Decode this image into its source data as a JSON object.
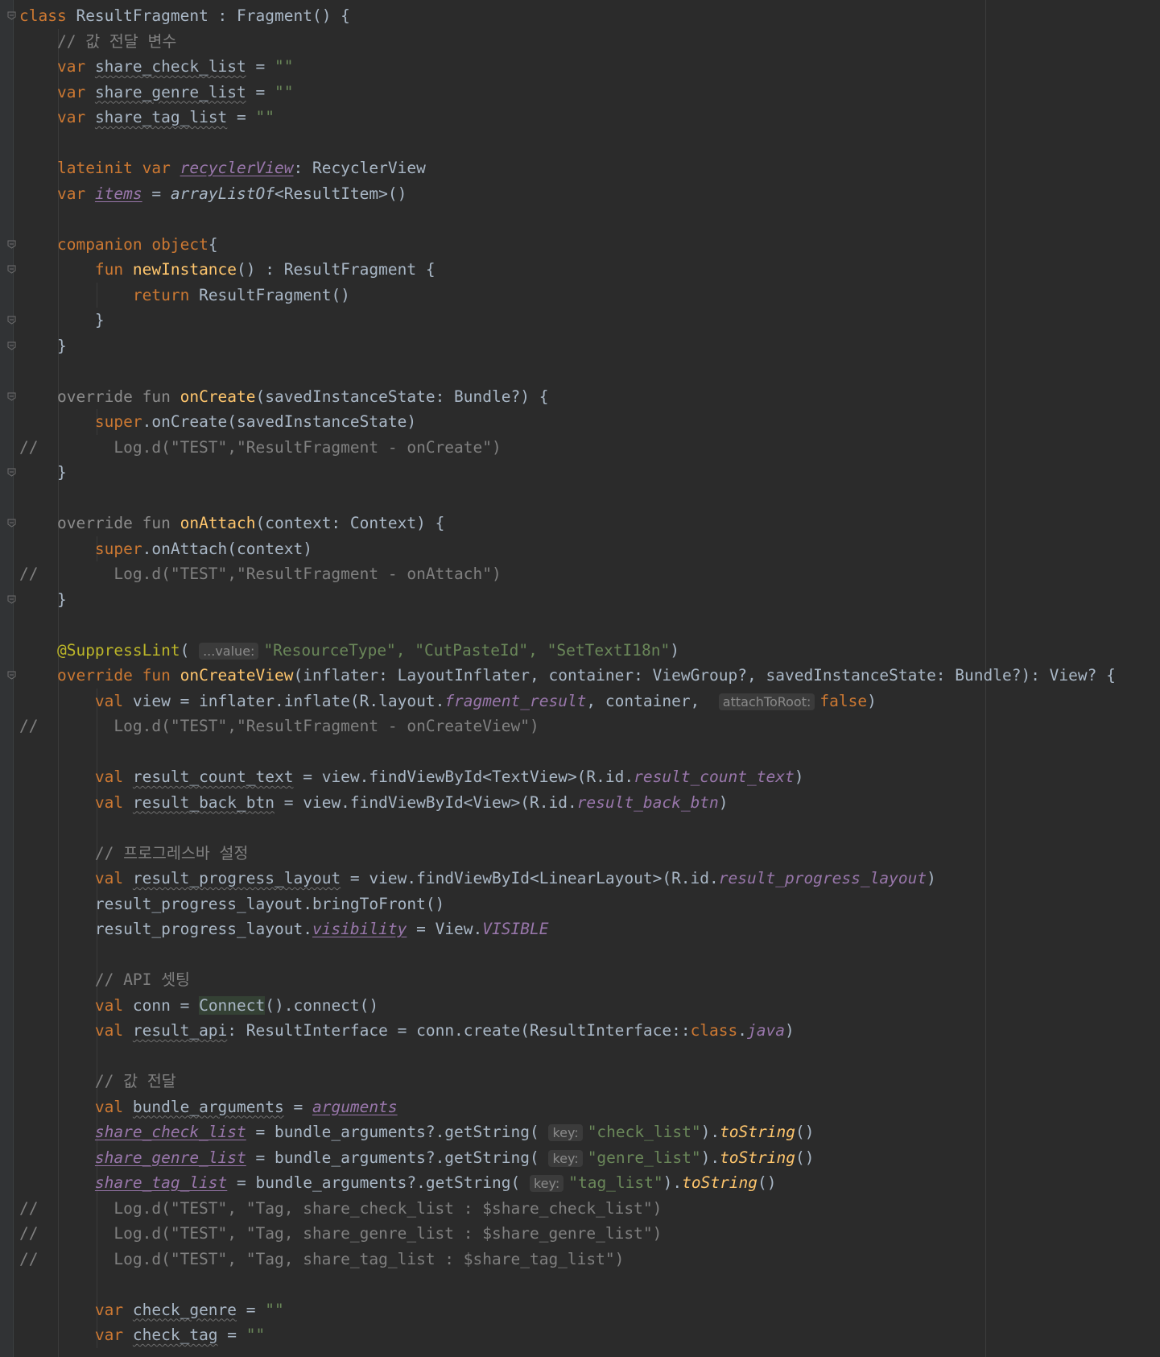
{
  "editor": {
    "language": "Kotlin",
    "lines": [
      [
        {
          "t": "class ",
          "c": "kw"
        },
        {
          "t": "ResultFragment : Fragment() {"
        }
      ],
      [
        {
          "t": "    "
        },
        {
          "t": "// 값 전달 변수",
          "c": "com"
        }
      ],
      [
        {
          "t": "    "
        },
        {
          "t": "var ",
          "c": "kw"
        },
        {
          "t": "share_check_list",
          "c": "wavy"
        },
        {
          "t": " = "
        },
        {
          "t": "\"\"",
          "c": "str"
        }
      ],
      [
        {
          "t": "    "
        },
        {
          "t": "var ",
          "c": "kw"
        },
        {
          "t": "share_genre_list",
          "c": "wavy"
        },
        {
          "t": " = "
        },
        {
          "t": "\"\"",
          "c": "str"
        }
      ],
      [
        {
          "t": "    "
        },
        {
          "t": "var ",
          "c": "kw"
        },
        {
          "t": "share_tag_list",
          "c": "wavy"
        },
        {
          "t": " = "
        },
        {
          "t": "\"\"",
          "c": "str"
        }
      ],
      [],
      [
        {
          "t": "    "
        },
        {
          "t": "lateinit var ",
          "c": "kw"
        },
        {
          "t": "recyclerView",
          "c": "link-prop"
        },
        {
          "t": ": RecyclerView"
        }
      ],
      [
        {
          "t": "    "
        },
        {
          "t": "var ",
          "c": "kw"
        },
        {
          "t": "items",
          "c": "link-prop"
        },
        {
          "t": " = "
        },
        {
          "t": "arrayListOf",
          "c": "ext"
        },
        {
          "t": "<ResultItem>()"
        }
      ],
      [],
      [
        {
          "t": "    "
        },
        {
          "t": "companion object",
          "c": "kw"
        },
        {
          "t": "{"
        }
      ],
      [
        {
          "t": "        "
        },
        {
          "t": "fun ",
          "c": "kw"
        },
        {
          "t": "newInstance",
          "c": "fn"
        },
        {
          "t": "() : ResultFragment {"
        }
      ],
      [
        {
          "t": "            "
        },
        {
          "t": "return ",
          "c": "kw"
        },
        {
          "t": "ResultFragment()"
        }
      ],
      [
        {
          "t": "        }"
        }
      ],
      [
        {
          "t": "    }"
        }
      ],
      [],
      [
        {
          "t": "    "
        },
        {
          "t": "override fun ",
          "c": "grey"
        },
        {
          "t": "onCreate",
          "c": "fn"
        },
        {
          "t": "(savedInstanceState: Bundle?) {"
        }
      ],
      [
        {
          "t": "        "
        },
        {
          "t": "super",
          "c": "kw"
        },
        {
          "t": ".onCreate(savedInstanceState)"
        }
      ],
      [
        {
          "t": "          Log.d(\"TEST\",\"ResultFragment - onCreate\")",
          "c": "com"
        }
      ],
      [
        {
          "t": "    }"
        }
      ],
      [],
      [
        {
          "t": "    "
        },
        {
          "t": "override fun ",
          "c": "grey"
        },
        {
          "t": "onAttach",
          "c": "fn"
        },
        {
          "t": "(context: Context) {"
        }
      ],
      [
        {
          "t": "        "
        },
        {
          "t": "super",
          "c": "kw"
        },
        {
          "t": ".onAttach(context)"
        }
      ],
      [
        {
          "t": "          Log.d(\"TEST\",\"ResultFragment - onAttach\")",
          "c": "com"
        }
      ],
      [
        {
          "t": "    }"
        }
      ],
      [],
      [
        {
          "t": "    "
        },
        {
          "t": "@SuppressLint",
          "c": "ann"
        },
        {
          "t": "( "
        },
        {
          "t": "...value:",
          "c": "hint"
        },
        {
          "t": "\"ResourceType\", \"CutPasteId\", \"SetTextI18n\"",
          "c": "str"
        },
        {
          "t": ")"
        }
      ],
      [
        {
          "t": "    "
        },
        {
          "t": "override fun ",
          "c": "kw"
        },
        {
          "t": "onCreateView",
          "c": "fn"
        },
        {
          "t": "(inflater: LayoutInflater, container: ViewGroup?, savedInstanceState: Bundle?): View? {"
        }
      ],
      [
        {
          "t": "        "
        },
        {
          "t": "val ",
          "c": "kw"
        },
        {
          "t": "view = inflater.inflate(R.layout."
        },
        {
          "t": "fragment_result",
          "c": "prop"
        },
        {
          "t": ", container,  "
        },
        {
          "t": "attachToRoot:",
          "c": "hint"
        },
        {
          "t": "false",
          "c": "kw"
        },
        {
          "t": ")"
        }
      ],
      [
        {
          "t": "          Log.d(\"TEST\",\"ResultFragment - onCreateView\")",
          "c": "com"
        }
      ],
      [],
      [
        {
          "t": "        "
        },
        {
          "t": "val ",
          "c": "kw"
        },
        {
          "t": "result_count_text",
          "c": "wavy"
        },
        {
          "t": " = view.findViewById<TextView>(R.id."
        },
        {
          "t": "result_count_text",
          "c": "prop"
        },
        {
          "t": ")"
        }
      ],
      [
        {
          "t": "        "
        },
        {
          "t": "val ",
          "c": "kw"
        },
        {
          "t": "result_back_btn",
          "c": "wavy"
        },
        {
          "t": " = view.findViewById<View>(R.id."
        },
        {
          "t": "result_back_btn",
          "c": "prop"
        },
        {
          "t": ")"
        }
      ],
      [],
      [
        {
          "t": "        "
        },
        {
          "t": "// 프로그레스바 설정",
          "c": "com"
        }
      ],
      [
        {
          "t": "        "
        },
        {
          "t": "val ",
          "c": "kw"
        },
        {
          "t": "result_progress_layout",
          "c": "wavy"
        },
        {
          "t": " = view.findViewById<LinearLayout>(R.id."
        },
        {
          "t": "result_progress_layout",
          "c": "prop"
        },
        {
          "t": ")"
        }
      ],
      [
        {
          "t": "        result_progress_layout.bringToFront()"
        }
      ],
      [
        {
          "t": "        result_progress_layout."
        },
        {
          "t": "visibility",
          "c": "link-prop"
        },
        {
          "t": " = View."
        },
        {
          "t": "VISIBLE",
          "c": "prop"
        }
      ],
      [],
      [
        {
          "t": "        "
        },
        {
          "t": "// API 셋팅",
          "c": "com"
        }
      ],
      [
        {
          "t": "        "
        },
        {
          "t": "val ",
          "c": "kw"
        },
        {
          "t": "conn = "
        },
        {
          "t": "Connect",
          "c": "hl"
        },
        {
          "t": "().connect()"
        }
      ],
      [
        {
          "t": "        "
        },
        {
          "t": "val ",
          "c": "kw"
        },
        {
          "t": "result_api",
          "c": "wavy"
        },
        {
          "t": ": ResultInterface = conn.create(ResultInterface::"
        },
        {
          "t": "class",
          "c": "kw"
        },
        {
          "t": "."
        },
        {
          "t": "java",
          "c": "prop"
        },
        {
          "t": ")"
        }
      ],
      [],
      [
        {
          "t": "        "
        },
        {
          "t": "// 값 전달",
          "c": "com"
        }
      ],
      [
        {
          "t": "        "
        },
        {
          "t": "val ",
          "c": "kw"
        },
        {
          "t": "bundle_arguments",
          "c": "wavy"
        },
        {
          "t": " = "
        },
        {
          "t": "arguments",
          "c": "link-prop"
        }
      ],
      [
        {
          "t": "        "
        },
        {
          "t": "share_check_list",
          "c": "link-prop"
        },
        {
          "t": " = bundle_arguments?.getString( "
        },
        {
          "t": "key:",
          "c": "hint"
        },
        {
          "t": "\"check_list\"",
          "c": "str"
        },
        {
          "t": ")."
        },
        {
          "t": "toString",
          "c": "fn ext"
        },
        {
          "t": "()"
        }
      ],
      [
        {
          "t": "        "
        },
        {
          "t": "share_genre_list",
          "c": "link-prop"
        },
        {
          "t": " = bundle_arguments?.getString( "
        },
        {
          "t": "key:",
          "c": "hint"
        },
        {
          "t": "\"genre_list\"",
          "c": "str"
        },
        {
          "t": ")."
        },
        {
          "t": "toString",
          "c": "fn ext"
        },
        {
          "t": "()"
        }
      ],
      [
        {
          "t": "        "
        },
        {
          "t": "share_tag_list",
          "c": "link-prop"
        },
        {
          "t": " = bundle_arguments?.getString( "
        },
        {
          "t": "key:",
          "c": "hint"
        },
        {
          "t": "\"tag_list\"",
          "c": "str"
        },
        {
          "t": ")."
        },
        {
          "t": "toString",
          "c": "fn ext"
        },
        {
          "t": "()"
        }
      ],
      [
        {
          "t": "          Log.d(\"TEST\", \"Tag, share_check_list : $share_check_list\")",
          "c": "com"
        }
      ],
      [
        {
          "t": "          Log.d(\"TEST\", \"Tag, share_genre_list : $share_genre_list\")",
          "c": "com"
        }
      ],
      [
        {
          "t": "          Log.d(\"TEST\", \"Tag, share_tag_list : $share_tag_list\")",
          "c": "com"
        }
      ],
      [],
      [
        {
          "t": "        "
        },
        {
          "t": "var ",
          "c": "kw"
        },
        {
          "t": "check_genre",
          "c": "wavy"
        },
        {
          "t": " = "
        },
        {
          "t": "\"\"",
          "c": "str"
        }
      ],
      [
        {
          "t": "        "
        },
        {
          "t": "var ",
          "c": "kw"
        },
        {
          "t": "check_tag",
          "c": "wavy"
        },
        {
          "t": " = "
        },
        {
          "t": "\"\"",
          "c": "str"
        }
      ]
    ],
    "comment_markers": [
      {
        "line": 17,
        "text": "//"
      },
      {
        "line": 22,
        "text": "//"
      },
      {
        "line": 28,
        "text": "//"
      },
      {
        "line": 47,
        "text": "//"
      },
      {
        "line": 48,
        "text": "//"
      },
      {
        "line": 49,
        "text": "//"
      }
    ],
    "fold_markers": [
      0,
      9,
      10,
      12,
      13,
      15,
      18,
      20,
      23,
      26
    ],
    "colors": {
      "background": "#2b2b2b",
      "keyword": "#cc7832",
      "function": "#ffc66d",
      "string": "#6a8759",
      "comment": "#808080",
      "annotation": "#bbb529",
      "property": "#9876aa",
      "default": "#a9b7c6"
    }
  }
}
